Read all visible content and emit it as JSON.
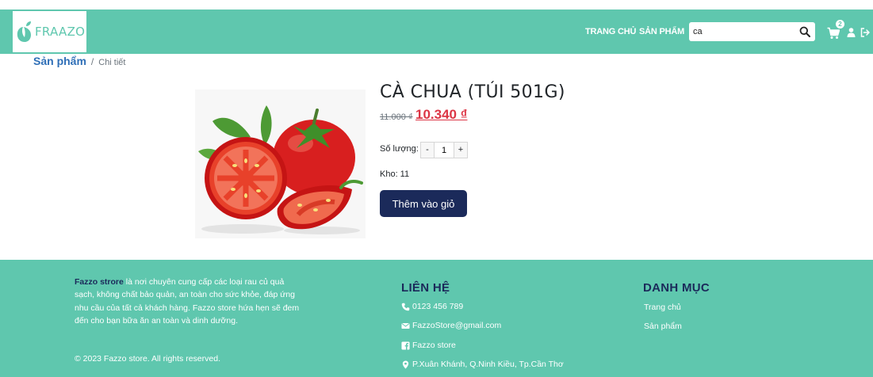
{
  "header": {
    "logo_text": "FRAAZO",
    "nav_home": "TRANG CHỦ",
    "nav_products": "SẢN PHẨM",
    "search_value": "ca",
    "cart_count": "2",
    "icons": {
      "search": "search-icon",
      "cart": "cart-icon",
      "user": "user-icon",
      "logout": "logout-icon"
    }
  },
  "breadcrumb": {
    "parent": "Sản phẩm",
    "separator": "/",
    "current": "Chi tiết"
  },
  "product": {
    "title": "CÀ CHUA (TÚI 501G)",
    "old_price": "11.000 ₫",
    "new_price": "10.340 ₫",
    "quantity_label": "Số lượng:",
    "minus_label": "-",
    "quantity": "1",
    "plus_label": "+",
    "stock_text": "Kho: 11",
    "add_to_cart_label": "Thêm vào giỏ"
  },
  "footer": {
    "brand": "Fazzo strore",
    "about_text": " là nơi chuyên cung cấp các loại rau củ quả sạch, không chất bảo quản, an toàn cho sức khỏe, đáp ứng nhu cầu của tất cả khách hàng. Fazzo store hứa hẹn sẽ đem đến cho bạn bữa ăn an toàn và dinh dưỡng.",
    "copyright": "© 2023 Fazzo store. All rights reserved.",
    "contact_title": "LIÊN HỆ",
    "phone": "0123 456 789",
    "email": "FazzoStore@gmail.com",
    "facebook": "Fazzo store",
    "address": "P.Xuân Khánh, Q.Ninh Kiều, Tp.Cần Thơ",
    "category_title": "DANH MỤC",
    "categories": [
      "Trang chủ",
      "Sản phẩm"
    ]
  },
  "colors": {
    "brand_teal": "#5fc7ae",
    "navy": "#1b2a5a",
    "price_red": "#dc3545",
    "link_blue": "#2f6fb7"
  }
}
